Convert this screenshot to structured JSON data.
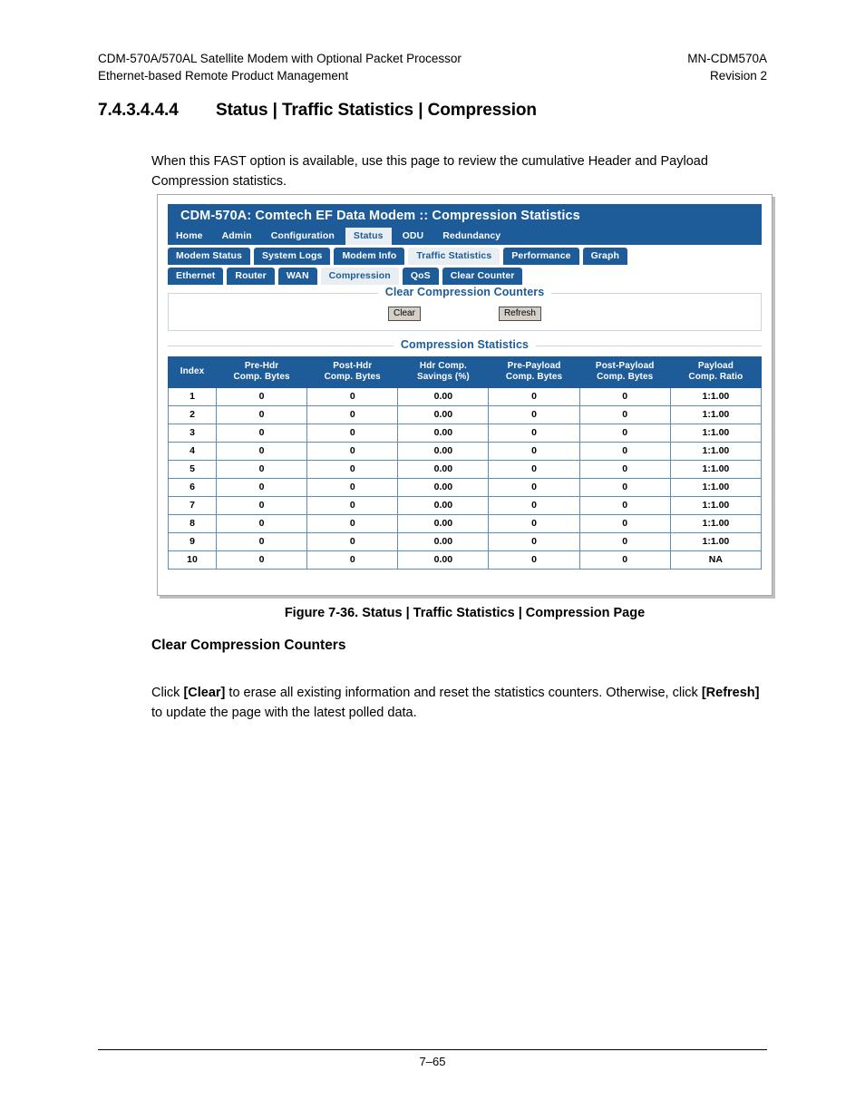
{
  "doc": {
    "header_left_line1": "CDM-570A/570AL Satellite Modem with Optional Packet Processor",
    "header_left_line2": "Ethernet-based Remote Product Management",
    "header_right_line1": "MN-CDM570A",
    "header_right_line2": "Revision 2",
    "section_number": "7.4.3.4.4.4",
    "section_title": "Status | Traffic Statistics | Compression",
    "intro_paragraph": "When this FAST option is available, use this page to review the cumulative Header and Payload Compression statistics.",
    "figure_caption": "Figure 7-36. Status | Traffic Statistics | Compression Page",
    "sub_heading": "Clear Compression Counters",
    "body_paragraph_parts": {
      "p1": "Click ",
      "b1": "[Clear]",
      "p2": " to erase all existing information and reset the statistics counters. Otherwise, click ",
      "b2": "[Refresh]",
      "p3": " to update the page with the latest polled data."
    },
    "page_number": "7–65"
  },
  "screenshot": {
    "titlebar": "CDM-570A: Comtech EF Data Modem :: Compression Statistics",
    "nav_row1": [
      {
        "label": "Home",
        "active": false
      },
      {
        "label": "Admin",
        "active": false
      },
      {
        "label": "Configuration",
        "active": false
      },
      {
        "label": "Status",
        "active": true
      },
      {
        "label": "ODU",
        "active": false
      },
      {
        "label": "Redundancy",
        "active": false
      }
    ],
    "nav_row2": [
      {
        "label": "Modem Status",
        "active": false
      },
      {
        "label": "System Logs",
        "active": false
      },
      {
        "label": "Modem Info",
        "active": false
      },
      {
        "label": "Traffic Statistics",
        "active": true
      },
      {
        "label": "Performance",
        "active": false
      },
      {
        "label": "Graph",
        "active": false
      }
    ],
    "nav_row3": [
      {
        "label": "Ethernet",
        "active": false
      },
      {
        "label": "Router",
        "active": false
      },
      {
        "label": "WAN",
        "active": false
      },
      {
        "label": "Compression",
        "active": true
      },
      {
        "label": "QoS",
        "active": false
      },
      {
        "label": "Clear Counter",
        "active": false
      }
    ],
    "clear_panel": {
      "legend": "Clear Compression Counters",
      "clear_button": "Clear",
      "refresh_button": "Refresh"
    },
    "stats_panel": {
      "legend": "Compression Statistics",
      "columns": [
        "Index",
        "Pre-Hdr\nComp. Bytes",
        "Post-Hdr\nComp. Bytes",
        "Hdr Comp.\nSavings (%)",
        "Pre-Payload\nComp. Bytes",
        "Post-Payload\nComp. Bytes",
        "Payload\nComp. Ratio"
      ],
      "rows": [
        [
          "1",
          "0",
          "0",
          "0.00",
          "0",
          "0",
          "1:1.00"
        ],
        [
          "2",
          "0",
          "0",
          "0.00",
          "0",
          "0",
          "1:1.00"
        ],
        [
          "3",
          "0",
          "0",
          "0.00",
          "0",
          "0",
          "1:1.00"
        ],
        [
          "4",
          "0",
          "0",
          "0.00",
          "0",
          "0",
          "1:1.00"
        ],
        [
          "5",
          "0",
          "0",
          "0.00",
          "0",
          "0",
          "1:1.00"
        ],
        [
          "6",
          "0",
          "0",
          "0.00",
          "0",
          "0",
          "1:1.00"
        ],
        [
          "7",
          "0",
          "0",
          "0.00",
          "0",
          "0",
          "1:1.00"
        ],
        [
          "8",
          "0",
          "0",
          "0.00",
          "0",
          "0",
          "1:1.00"
        ],
        [
          "9",
          "0",
          "0",
          "0.00",
          "0",
          "0",
          "1:1.00"
        ],
        [
          "10",
          "0",
          "0",
          "0.00",
          "0",
          "0",
          "NA"
        ]
      ]
    },
    "colors": {
      "nav_blue": "#1d5c99",
      "active_tab_bg": "#e8eef2",
      "cell_border": "#5b8db8",
      "panel_border": "#c8d4de"
    }
  }
}
